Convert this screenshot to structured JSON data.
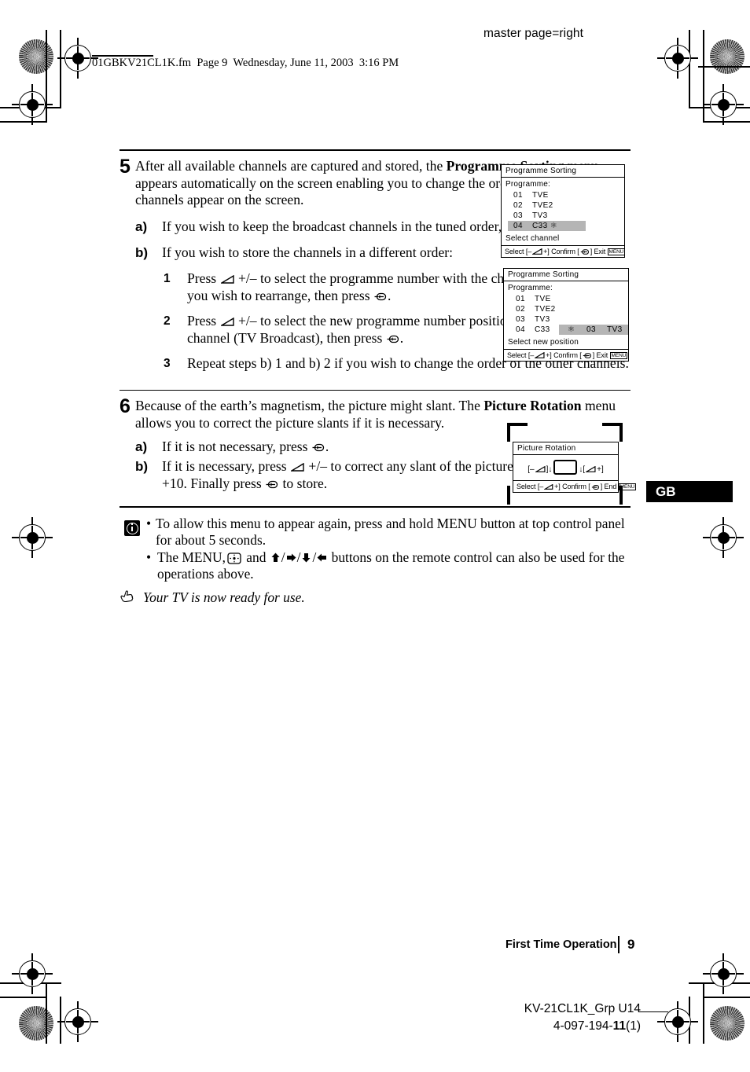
{
  "header": {
    "master_page": "master page=right",
    "file_line": "01GBKV21CL1K.fm  Page 9  Wednesday, June 11, 2003  3:16 PM"
  },
  "steps": [
    {
      "number": "5",
      "text_before_bold": "After all available channels are captured and stored, the ",
      "bold_term": "Programme Sorting",
      "text_after_bold": " menu appears automatically on the screen enabling you to change the order in which the channels appear on the screen.",
      "subitems": [
        {
          "label": "a)",
          "text": "If you wish to keep the broadcast channels in the tuned order, press MENU."
        },
        {
          "label": "b)",
          "text": "If you wish to store the channels in a different order:"
        }
      ],
      "numbered": [
        {
          "label": "1",
          "part1": "Press ",
          "part2": " +/– to select the programme number with the channel (TV Broadcast) you wish to rearrange, then press ",
          "part3": "."
        },
        {
          "label": "2",
          "part1": "Press ",
          "part2": " +/– to select the new programme number position for your selected channel (TV Broadcast), then press ",
          "part3": "."
        },
        {
          "label": "3",
          "part1": "Repeat steps b) 1 and b) 2 if you wish to change the order of the other channels.",
          "part2": "",
          "part3": ""
        }
      ]
    },
    {
      "number": "6",
      "text_before_bold": "Because of the earth’s magnetism, the picture might slant. The ",
      "bold_term": "Picture Rotation",
      "text_after_bold": " menu allows you to correct the picture slants if it is necessary.",
      "subitems": [
        {
          "label": "a)",
          "text_pre": "If it is not necessary, press ",
          "text_post": "."
        },
        {
          "label": "b)",
          "text_pre": "If it is necessary, press ",
          "text_mid": " +/– to correct any slant of the picture between –10 and +10. Finally press ",
          "text_post": " to store."
        }
      ]
    }
  ],
  "osd": {
    "sorting_1": {
      "title": "Programme Sorting",
      "programme_label": "Programme:",
      "rows": [
        {
          "number": "01",
          "name": "TVE",
          "selected": false
        },
        {
          "number": "02",
          "name": "TVE2",
          "selected": false
        },
        {
          "number": "03",
          "name": "TV3",
          "selected": false
        },
        {
          "number": "04",
          "name": "C33",
          "selected": true
        }
      ],
      "hint": "Select channel",
      "footer_select": "Select [–",
      "footer_select_end": "+]",
      "footer_confirm": "Confirm [",
      "footer_confirm_end": "]",
      "footer_exit": "Exit",
      "footer_exit_key": "MENU"
    },
    "sorting_2": {
      "title": "Programme Sorting",
      "programme_label": "Programme:",
      "rows": [
        {
          "number": "01",
          "name": "TVE",
          "selected": false
        },
        {
          "number": "02",
          "name": "TVE2",
          "selected": false
        },
        {
          "number": "03",
          "name": "TV3",
          "selected": false
        },
        {
          "number": "04",
          "name": "C33",
          "selected": false
        }
      ],
      "target_number": "03",
      "target_name": "TV3",
      "hint": "Select new position",
      "footer_select": "Select [–",
      "footer_select_end": "+]",
      "footer_confirm": "Confirm [",
      "footer_confirm_end": "]",
      "footer_exit": "Exit",
      "footer_exit_key": "MENU"
    },
    "picture_rotation": {
      "title": "Picture Rotation",
      "left_key": "[–",
      "right_key": "+]",
      "footer_select": "Select [–",
      "footer_select_end": "+]",
      "footer_confirm": "Confirm [",
      "footer_confirm_end": "]",
      "footer_end": "End",
      "footer_end_key": "MENU"
    }
  },
  "notes": {
    "items": [
      "To allow this menu to appear again, press and hold MENU button at top control panel for about 5 seconds.",
      "The MENU,"
    ],
    "note2_mid": " and ",
    "note2_tail": " buttons on the remote control can also be used for the operations above.",
    "bullet": "•"
  },
  "tip": "Your TV is now ready for use.",
  "language_tab": "GB",
  "footer": {
    "running_head": "First Time Operation",
    "page_number": "9",
    "model": "KV-21CL1K_Grp U14",
    "part_prefix": "4-097-194-",
    "part_bold": "11",
    "part_suffix": "(1)"
  }
}
